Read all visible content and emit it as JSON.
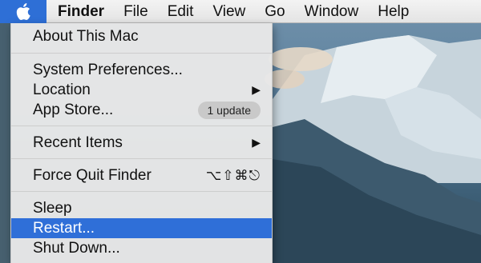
{
  "menubar": {
    "apple_icon": "apple-logo-icon",
    "app_name": "Finder",
    "menus": [
      "File",
      "Edit",
      "View",
      "Go",
      "Window",
      "Help"
    ]
  },
  "apple_menu": {
    "about": "About This Mac",
    "system_preferences": "System Preferences...",
    "location": "Location",
    "app_store": "App Store...",
    "app_store_badge": "1 update",
    "recent_items": "Recent Items",
    "force_quit": "Force Quit Finder",
    "force_quit_shortcut": "⌥⇧⌘⎋",
    "sleep": "Sleep",
    "restart": "Restart...",
    "shut_down": "Shut Down...",
    "submenu_arrow": "▶"
  },
  "colors": {
    "selection": "#2f6fd8",
    "apple_tab": "#2e6fd6"
  }
}
